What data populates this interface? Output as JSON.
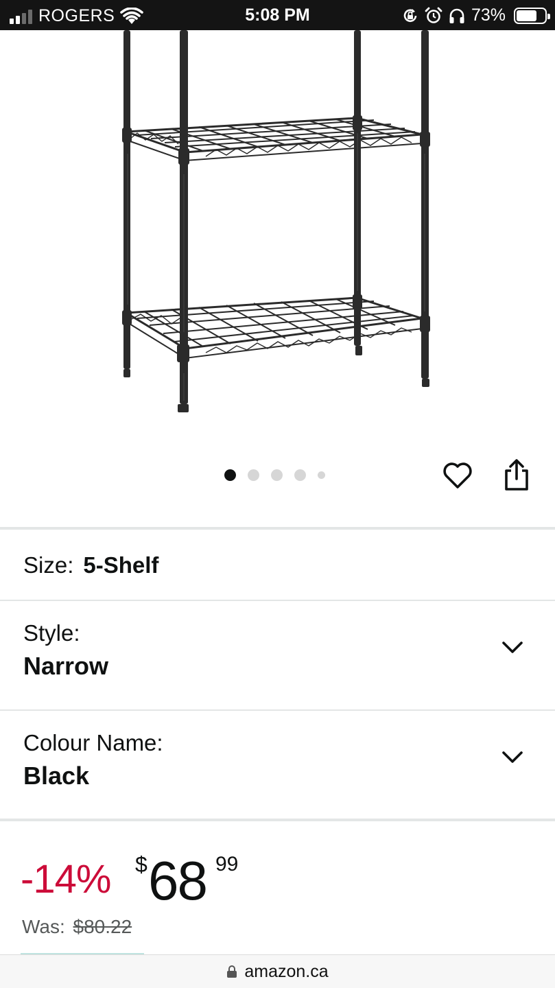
{
  "status_bar": {
    "carrier": "ROGERS",
    "time": "5:08 PM",
    "battery_percent": "73%",
    "battery_level": 0.73,
    "signal_bars_active": 2,
    "icons": [
      "wifi-icon",
      "rotation-lock-icon",
      "alarm-icon",
      "headphones-icon",
      "battery-icon"
    ]
  },
  "product_image": {
    "alt": "wire shelving unit",
    "carousel_total": 5,
    "carousel_active": 1
  },
  "actions": {
    "wishlist_icon": "heart-icon",
    "share_icon": "share-icon"
  },
  "variations": {
    "size": {
      "label": "Size:",
      "value": "5-Shelf"
    },
    "style": {
      "label": "Style:",
      "value": "Narrow"
    },
    "colour": {
      "label": "Colour Name:",
      "value": "Black"
    }
  },
  "price": {
    "discount": "-14%",
    "currency": "$",
    "whole": "68",
    "fraction": "99",
    "was_label": "Was:",
    "was_price": "$80.22",
    "discount_color": "#cc0c39"
  },
  "browser": {
    "url": "amazon.ca"
  }
}
